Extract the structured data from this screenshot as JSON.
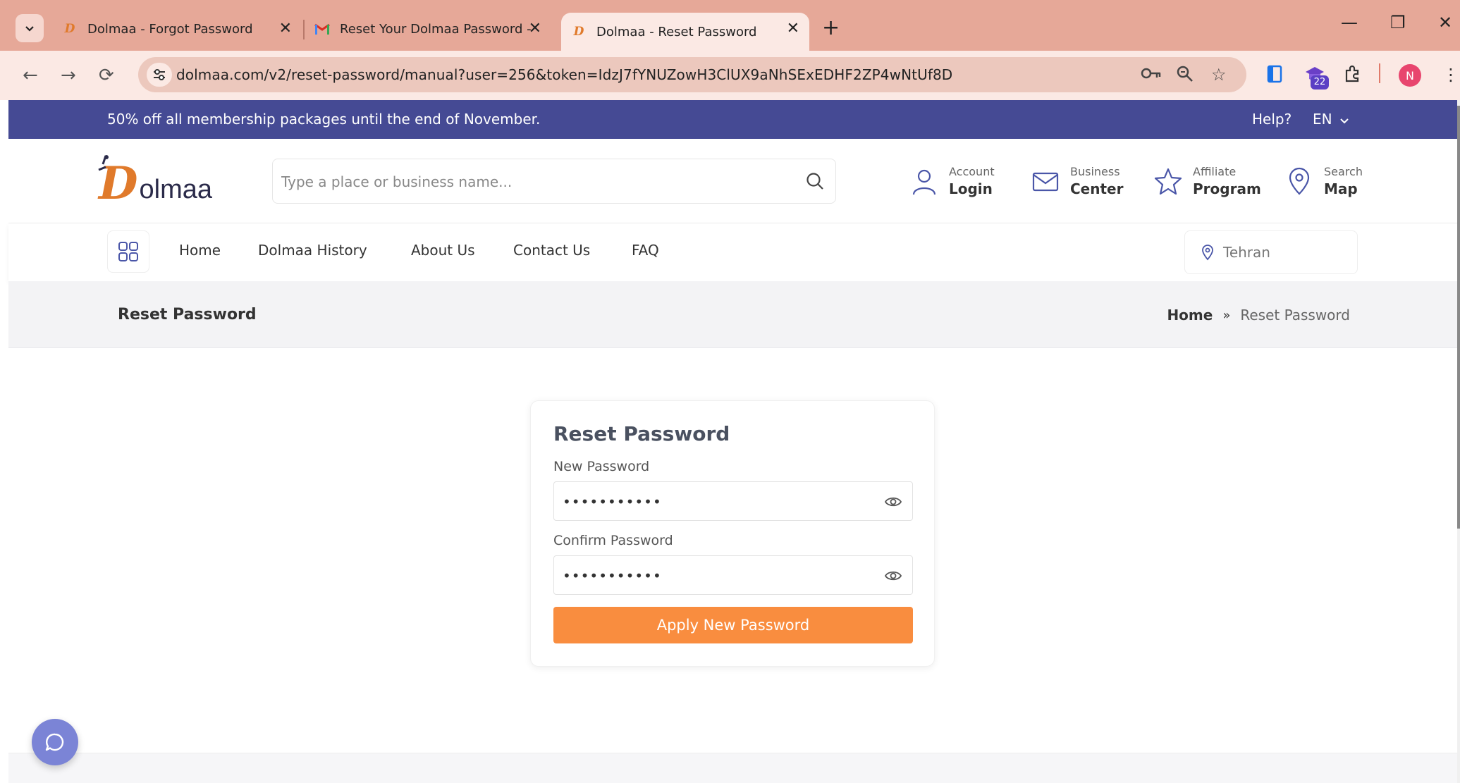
{
  "browser": {
    "tabs": [
      {
        "title": "Dolmaa - Forgot Password",
        "active": false
      },
      {
        "title": "Reset Your Dolmaa Password - ",
        "active": false
      },
      {
        "title": "Dolmaa - Reset Password",
        "active": true
      }
    ],
    "url": "dolmaa.com/v2/reset-password/manual?user=256&token=IdzJ7fYNUZowH3ClUX9aNhSExEDHF2ZP4wNtUf8D",
    "extension_badge": "22",
    "profile_initial": "N"
  },
  "promo": {
    "message": "50% off all membership packages until the end of November.",
    "help": "Help?",
    "language": "EN"
  },
  "header": {
    "logo_initial": "D",
    "logo_rest": "olmaa",
    "search_placeholder": "Type a place or business name...",
    "links": [
      {
        "top": "Account",
        "bottom": "Login",
        "icon": "user-icon"
      },
      {
        "top": "Business",
        "bottom": "Center",
        "icon": "mail-icon"
      },
      {
        "top": "Affiliate",
        "bottom": "Program",
        "icon": "star-icon"
      },
      {
        "top": "Search",
        "bottom": "Map",
        "icon": "map-pin-icon"
      }
    ]
  },
  "menu": {
    "items": [
      "Home",
      "Dolmaa History",
      "About Us",
      "Contact Us",
      "FAQ"
    ],
    "city": "Tehran"
  },
  "breadcrumb": {
    "page_title": "Reset Password",
    "home": "Home",
    "current": "Reset Password"
  },
  "form": {
    "title": "Reset Password",
    "new_password_label": "New Password",
    "new_password_value": "•••••••••••",
    "confirm_password_label": "Confirm Password",
    "confirm_password_value": "•••••••••••",
    "submit_label": "Apply New Password"
  },
  "colors": {
    "promo_bg": "#454a94",
    "accent_orange": "#f98d3f",
    "tabbar_bg": "#e6a898"
  }
}
